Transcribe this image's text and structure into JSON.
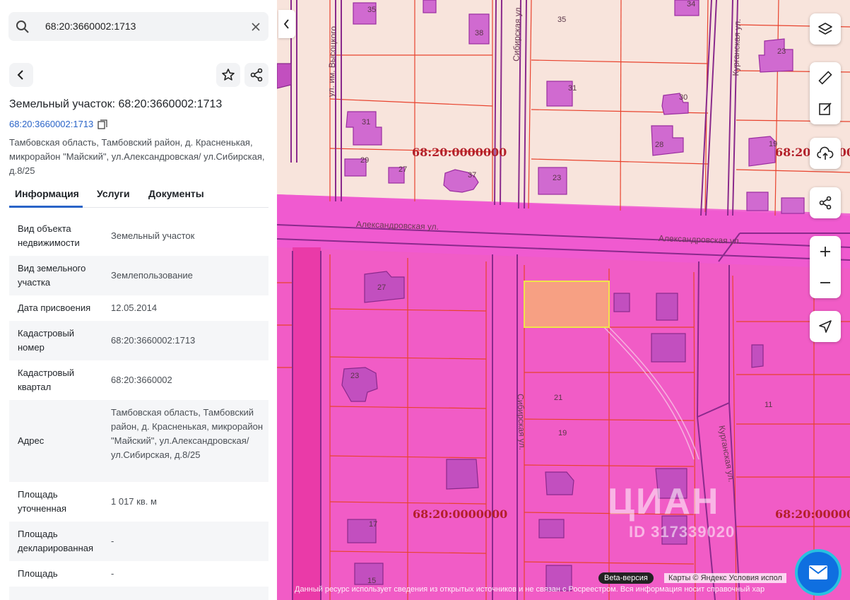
{
  "search": {
    "value": "68:20:3660002:1713"
  },
  "header": {
    "title": "Земельный участок: 68:20:3660002:1713",
    "cad_link": "68:20:3660002:1713",
    "address": "Тамбовская область, Тамбовский район, д. Красненькая, микрорайон \"Майский\", ул.Александровская/ ул.Сибирская, д.8/25"
  },
  "tabs": [
    "Информация",
    "Услуги",
    "Документы"
  ],
  "info_rows": [
    {
      "k": "Вид объекта недвижимости",
      "v": "Земельный участок"
    },
    {
      "k": "Вид земельного участка",
      "v": "Землепользование"
    },
    {
      "k": "Дата присвоения",
      "v": "12.05.2014"
    },
    {
      "k": "Кадастровый номер",
      "v": "68:20:3660002:1713"
    },
    {
      "k": "Кадастровый квартал",
      "v": "68:20:3660002"
    },
    {
      "k": "Адрес",
      "v": "Тамбовская область, Тамбовский район, д. Красненькая, микрорайон \"Майский\", ул.Александровская/ ул.Сибирская, д.8/25"
    },
    {
      "k": "Площадь уточненная",
      "v": "1 017 кв. м"
    },
    {
      "k": "Площадь декларированная",
      "v": "-"
    },
    {
      "k": "Площадь",
      "v": "-"
    }
  ],
  "map": {
    "streets": {
      "aleks_1": "Александровская ул.",
      "aleks_2": "Александровская ул.",
      "sibir_top": "Сибирская ул.",
      "sibir_bottom": "Сибирская ул.",
      "kurgan_top": "Курганская ул.",
      "kurgan_bottom": "Курганская ул.",
      "vysotsky": "ул. им. Высоцкого"
    },
    "quarter_label": "68:20:0000000",
    "plot_numbers": {
      "p35a": "35",
      "p38": "38",
      "p35b": "35",
      "p34": "34",
      "p23a": "23",
      "p31a": "31",
      "p29": "29",
      "p27a": "27",
      "p37": "37",
      "p31b": "31",
      "p30": "30",
      "p28": "28",
      "p23b": "23",
      "p19a": "19",
      "p27b": "27",
      "p23c": "23",
      "p21": "21",
      "p19b": "19",
      "p17": "17",
      "p11": "11",
      "p15": "15"
    },
    "beta": "Beta-версия",
    "credit": "Карты © Яндекс   Условия испол",
    "disclaimer": "Данный ресурс использует сведения из открытых источников и не связан с Росреестром. Вся информация носит справочный хар",
    "watermark_brand": "ЦИАН",
    "watermark_id": "ID 317339020"
  },
  "colors": {
    "accent": "#2a64c8",
    "zone": "#f05ac8",
    "selected": "#f7a083",
    "boundary": "#e8432e"
  }
}
